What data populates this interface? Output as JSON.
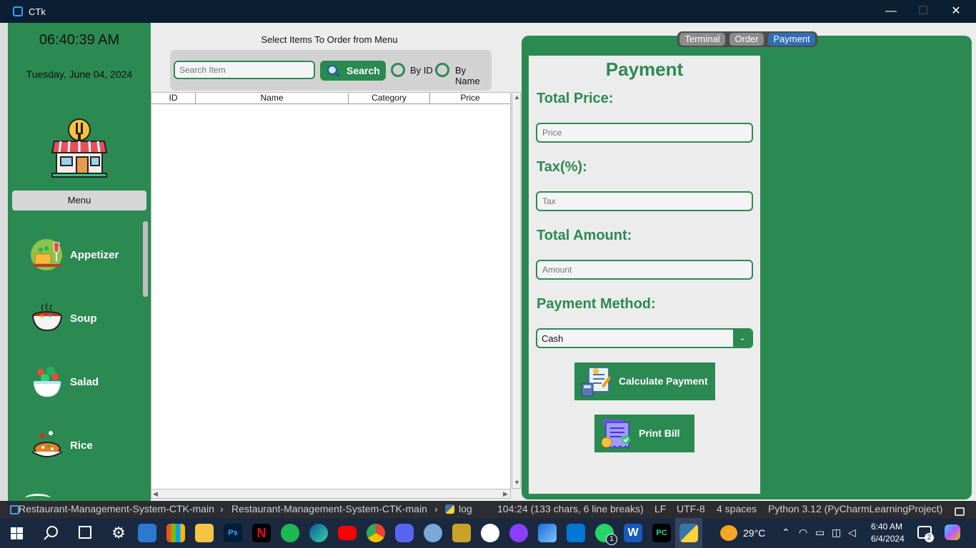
{
  "window": {
    "title": "CTk",
    "controls": {
      "minimize": "—",
      "maximize": "☐",
      "close": "✕"
    }
  },
  "sidebar": {
    "clock": "06:40:39 AM",
    "date": "Tuesday, June 04, 2024",
    "menu_button": "Menu",
    "categories": [
      {
        "label": "Appetizer",
        "icon": "appetizer-icon"
      },
      {
        "label": "Soup",
        "icon": "soup-bowl-icon"
      },
      {
        "label": "Salad",
        "icon": "salad-bowl-icon"
      },
      {
        "label": "Rice",
        "icon": "rice-plate-icon"
      }
    ]
  },
  "order_panel": {
    "heading": "Select Items To Order from Menu",
    "search_placeholder": "Search Item",
    "search_button": "Search",
    "radio_by_id": "By ID",
    "radio_by_name": "By Name",
    "table_columns": [
      "ID",
      "Name",
      "Category",
      "Price"
    ]
  },
  "tabs": {
    "items": [
      "Terminal",
      "Order",
      "Payment"
    ],
    "selected": "Payment"
  },
  "payment": {
    "title": "Payment",
    "total_price_label": "Total Price:",
    "price_placeholder": "Price",
    "tax_label": "Tax(%):",
    "tax_placeholder": "Tax",
    "total_amount_label": "Total Amount:",
    "amount_placeholder": "Amount",
    "method_label": "Payment Method:",
    "method_value": "Cash",
    "calculate_button": "Calculate Payment",
    "print_button": "Print Bill"
  },
  "statusbar": {
    "breadcrumb": [
      "Restaurant-Management-System-CTK-main",
      "Restaurant-Management-System-CTK-main",
      "log"
    ],
    "position": "104:24 (133 chars, 6 line breaks)",
    "line_ending": "LF",
    "encoding": "UTF-8",
    "indent": "4 spaces",
    "interpreter": "Python 3.12 (PyCharmLearningProject)"
  },
  "taskbar": {
    "weather": "29°C",
    "time": "6:40 AM",
    "date": "6/4/2024",
    "notifications": "2",
    "whatsapp_badge": "1"
  },
  "colors": {
    "accent": "#2b8a52",
    "panel": "#ececec",
    "tab_selected": "#2f6fb3"
  }
}
